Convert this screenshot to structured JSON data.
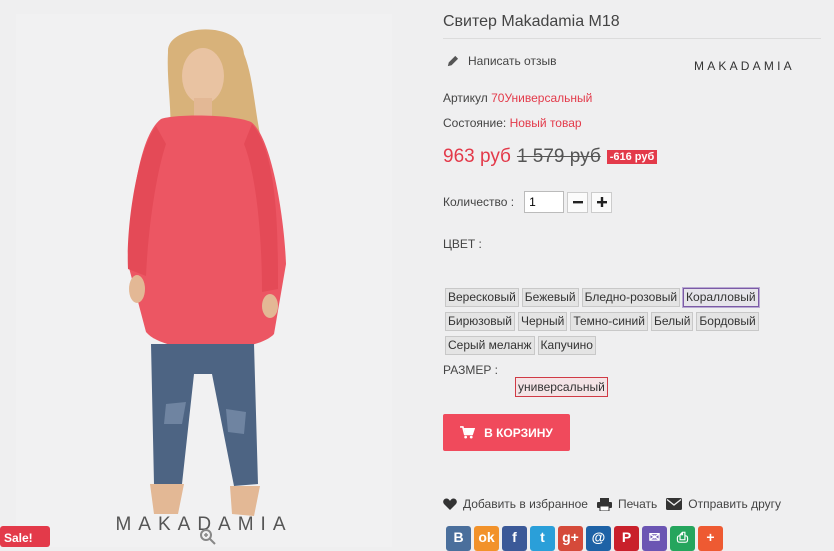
{
  "product": {
    "title": "Свитер Makadamia M18",
    "brand": "MAKADAMIA",
    "image_watermark": "MAKADAMIA",
    "review_label": "Написать отзыв",
    "article_label": "Артикул",
    "article_value": "70Универсальный",
    "condition_label": "Состояние:",
    "condition_value": "Новый товар",
    "price_now": "963 руб",
    "price_old": "1 579 руб",
    "discount": "-616 руб",
    "quantity_label": "Количество :",
    "quantity_value": "1",
    "color_label": "ЦВЕТ :",
    "size_label": "РАЗМЕР :",
    "colors": [
      [
        "Вересковый",
        "Бежевый",
        "Бледно-розовый",
        "Коралловый"
      ],
      [
        "Бирюзовый",
        "Черный",
        "Темно-синий",
        "Белый",
        "Бордовый"
      ],
      [
        "Серый меланж",
        "Капучино"
      ]
    ],
    "selected_color": "Коралловый",
    "size_value": "универсальный",
    "cart_label": "В КОРЗИНУ",
    "wishlist_label": "Добавить в избранное",
    "print_label": "Печать",
    "send_label": "Отправить другу",
    "sale_badge_text": "Sale!"
  },
  "share_icons": [
    {
      "name": "vk-share-icon",
      "glyph": "B",
      "color": "#4a6f9c"
    },
    {
      "name": "ok-share-icon",
      "glyph": "ok",
      "color": "#f2922a"
    },
    {
      "name": "facebook-share-icon",
      "glyph": "f",
      "color": "#3b5998"
    },
    {
      "name": "twitter-share-icon",
      "glyph": "t",
      "color": "#2a9fd9"
    },
    {
      "name": "googleplus-share-icon",
      "glyph": "g+",
      "color": "#d54a3a"
    },
    {
      "name": "mailru-share-icon",
      "glyph": "@",
      "color": "#1e62a6"
    },
    {
      "name": "pinterest-share-icon",
      "glyph": "P",
      "color": "#c9202b"
    },
    {
      "name": "email-share-icon",
      "glyph": "✉",
      "color": "#6b55b3"
    },
    {
      "name": "print-share-icon",
      "glyph": "⎙",
      "color": "#25a55d"
    },
    {
      "name": "more-share-icon",
      "glyph": "+",
      "color": "#ee5a32"
    }
  ],
  "colors": {
    "accent": "#e33a4a",
    "button": "#f04a5c",
    "selected_outline": "#7b5aa6"
  }
}
